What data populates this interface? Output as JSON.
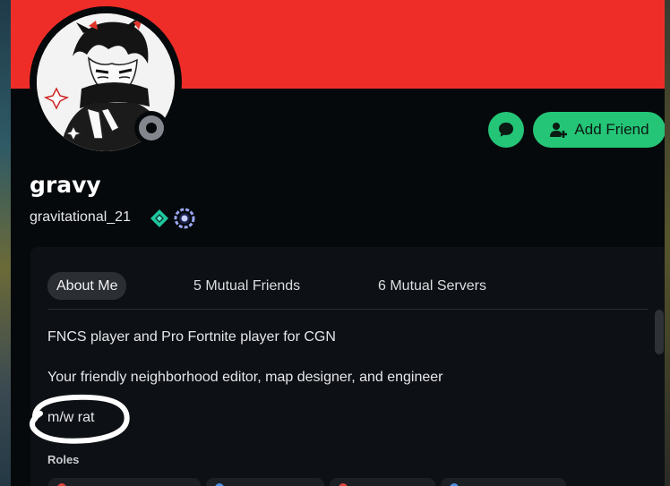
{
  "profile": {
    "display_name": "gravy",
    "username": "gravitational_21",
    "status": "offline"
  },
  "actions": {
    "message_icon": "chat-bubble-icon",
    "add_friend_label": "Add Friend",
    "add_friend_icon": "person-plus-icon"
  },
  "badges": [
    "gem-badge-icon",
    "laurel-badge-icon"
  ],
  "tabs": [
    {
      "label": "About Me",
      "active": true
    },
    {
      "label": "5 Mutual Friends",
      "active": false
    },
    {
      "label": "6 Mutual Servers",
      "active": false
    }
  ],
  "about": {
    "line1": "FNCS player and Pro Fortnite player for CGN",
    "line2": "Your friendly neighborhood editor, map designer, and engineer",
    "line3": "m/w rat"
  },
  "roles": {
    "heading": "Roles",
    "role_colors": [
      "#e0443a",
      "#4b8fe0",
      "#e0443a",
      "#4b8fe0"
    ]
  },
  "colors": {
    "banner": "#ef2d28",
    "accent_green": "#24c577",
    "status_offline": "#83868c"
  }
}
